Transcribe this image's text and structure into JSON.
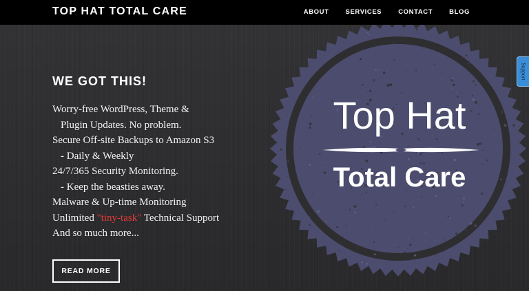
{
  "header": {
    "brand": "TOP HAT TOTAL CARE",
    "nav": [
      {
        "label": "ABOUT"
      },
      {
        "label": "SERVICES"
      },
      {
        "label": "CONTACT"
      },
      {
        "label": "BLOG"
      }
    ]
  },
  "hero": {
    "heading": "WE GOT THIS!",
    "features": [
      "Worry-free WordPress, Theme &",
      "Plugin Updates. No problem.",
      "Secure Off-site Backups to Amazon S3",
      "- Daily & Weekly",
      "24/7/365 Security Monitoring.",
      "- Keep the beasties away.",
      "Malware & Up-time Monitoring"
    ],
    "support_line": {
      "prefix": "Unlimited ",
      "highlight": "\"tiny-task\"",
      "suffix": " Technical Support"
    },
    "last_line": "And so much more...",
    "button_label": "READ MORE"
  },
  "seal": {
    "title": "Top Hat",
    "subtitle": "Total Care"
  },
  "support_tab": {
    "label": "Support"
  },
  "colors": {
    "header_bg": "#000000",
    "page_bg": "#2f2f31",
    "seal_fill": "#4c4c6e",
    "seal_ring": "#2e2e31",
    "highlight": "#e53935",
    "support_tab": "#3a8ed8"
  }
}
